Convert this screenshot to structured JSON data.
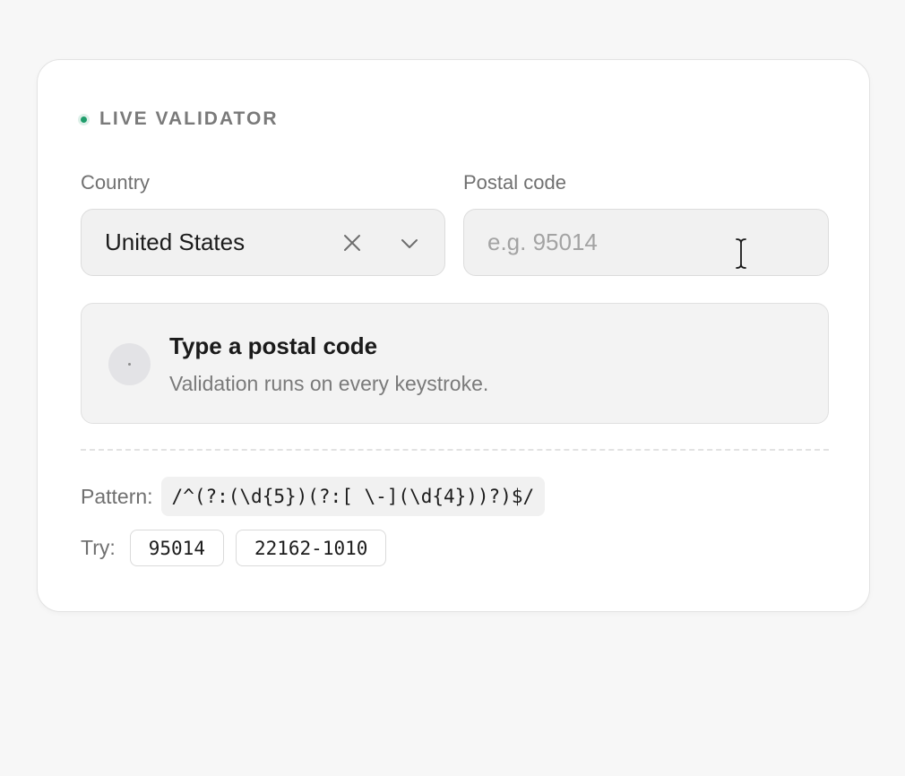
{
  "header": {
    "eyebrow_label": "LIVE VALIDATOR",
    "status_dot_color": "#1f9d6b"
  },
  "form": {
    "country_label": "Country",
    "country_value": "United States",
    "country_clear_icon": "close-icon",
    "country_dropdown_icon": "chevron-down-icon",
    "postal_label": "Postal code",
    "postal_placeholder": "e.g. 95014",
    "postal_value": ""
  },
  "status": {
    "title": "Type a postal code",
    "subtitle": "Validation runs on every keystroke.",
    "icon": "neutral-dot-icon"
  },
  "pattern": {
    "label": "Pattern:",
    "regex": "/^(?:(\\d{5})(?:[ \\-](\\d{4}))?)$/"
  },
  "examples": {
    "label": "Try:",
    "items": [
      "95014",
      "22162-1010"
    ]
  }
}
